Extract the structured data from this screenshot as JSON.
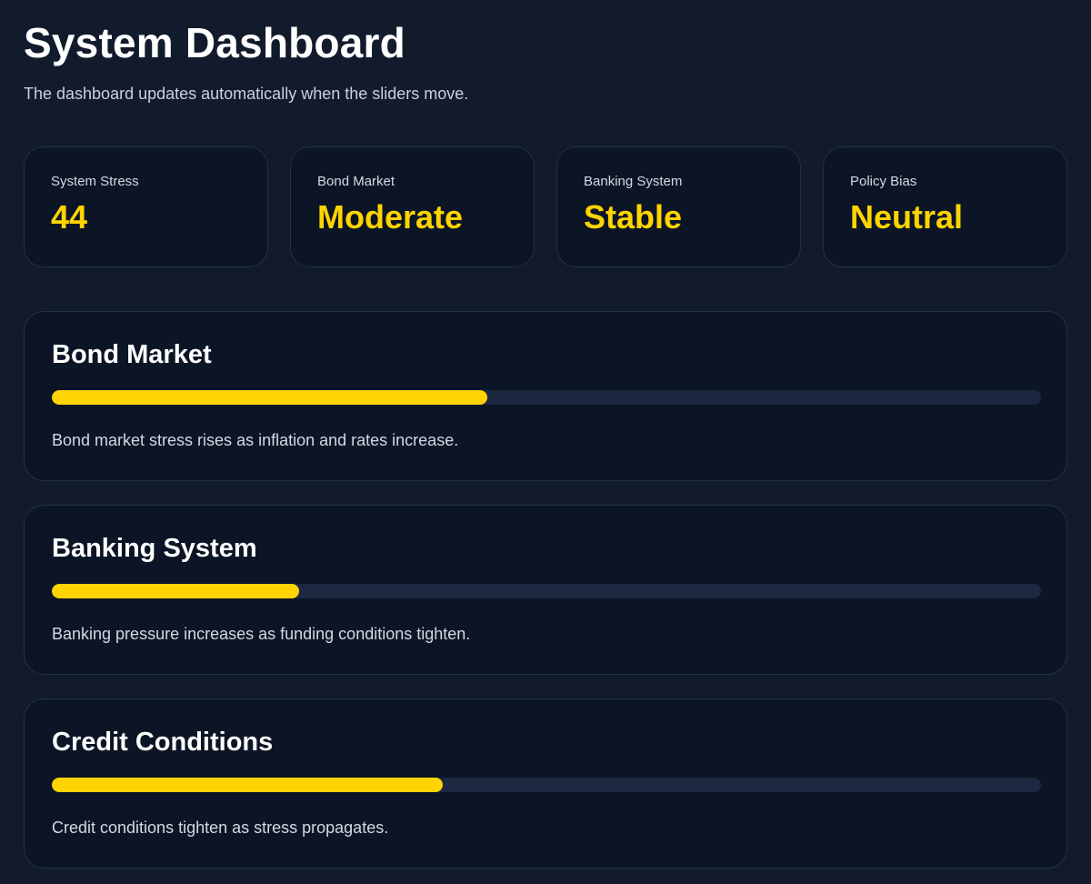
{
  "header": {
    "title": "System Dashboard",
    "subtitle": "The dashboard updates automatically when the sliders move."
  },
  "stats": [
    {
      "label": "System Stress",
      "value": "44"
    },
    {
      "label": "Bond Market",
      "value": "Moderate"
    },
    {
      "label": "Banking System",
      "value": "Stable"
    },
    {
      "label": "Policy Bias",
      "value": "Neutral"
    }
  ],
  "panels": [
    {
      "title": "Bond Market",
      "level_percent": 44,
      "description": "Bond market stress rises as inflation and rates increase."
    },
    {
      "title": "Banking System",
      "level_percent": 25,
      "description": "Banking pressure increases as funding conditions tighten."
    },
    {
      "title": "Credit Conditions",
      "level_percent": 39.5,
      "description": "Credit conditions tighten as stress propagates."
    }
  ],
  "colors": {
    "background": "#111b2c",
    "card": "#0c1525",
    "border": "#24304a",
    "accent": "#ffd400",
    "track": "#1c2840"
  }
}
